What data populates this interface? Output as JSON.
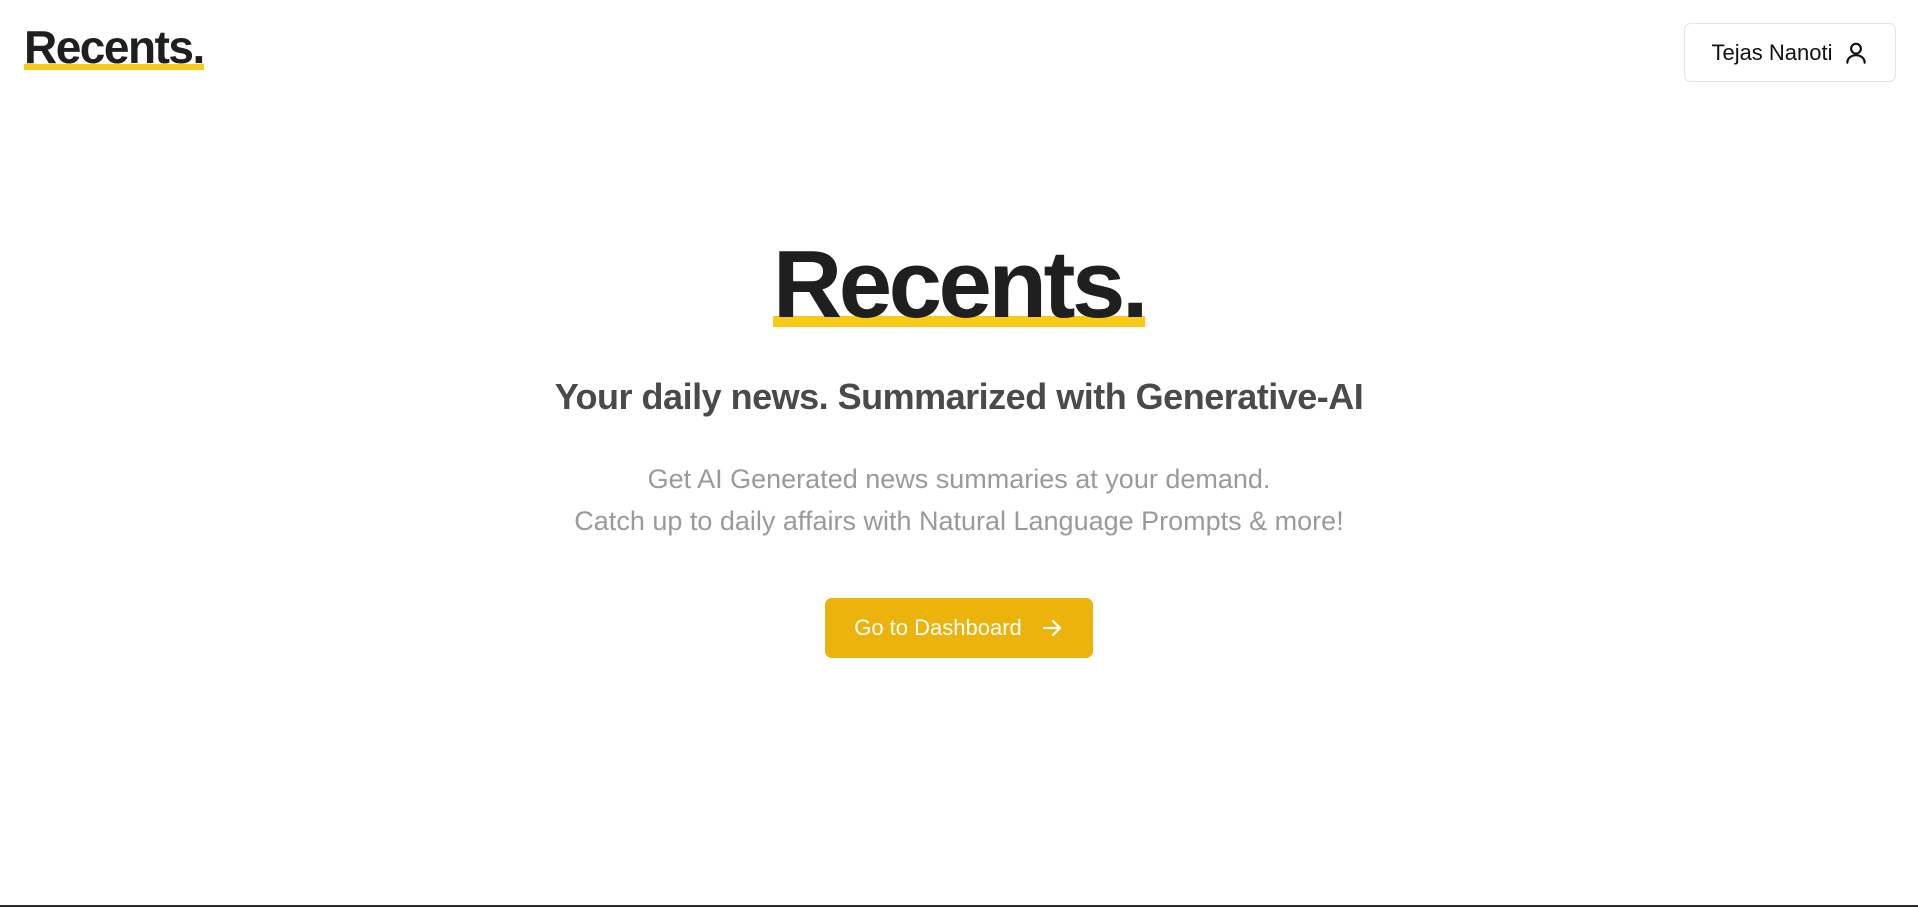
{
  "header": {
    "brand": "Recents.",
    "user_button": {
      "name": "Tejas Nanoti",
      "icon": "user-icon"
    }
  },
  "hero": {
    "logo": "Recents.",
    "tagline": "Your daily news. Summarized with Generative-AI",
    "description": [
      "Get AI Generated news summaries at your demand.",
      "Catch up to daily affairs with Natural Language Prompts & more!"
    ],
    "cta": {
      "label": "Go to Dashboard",
      "icon": "arrow-right-icon"
    }
  },
  "colors": {
    "accent": "#f8cc16",
    "button": "#ebb30b",
    "text_dark": "#1f1f1f",
    "text_muted": "#9a9a9a",
    "tagline": "#4a4a4a"
  }
}
